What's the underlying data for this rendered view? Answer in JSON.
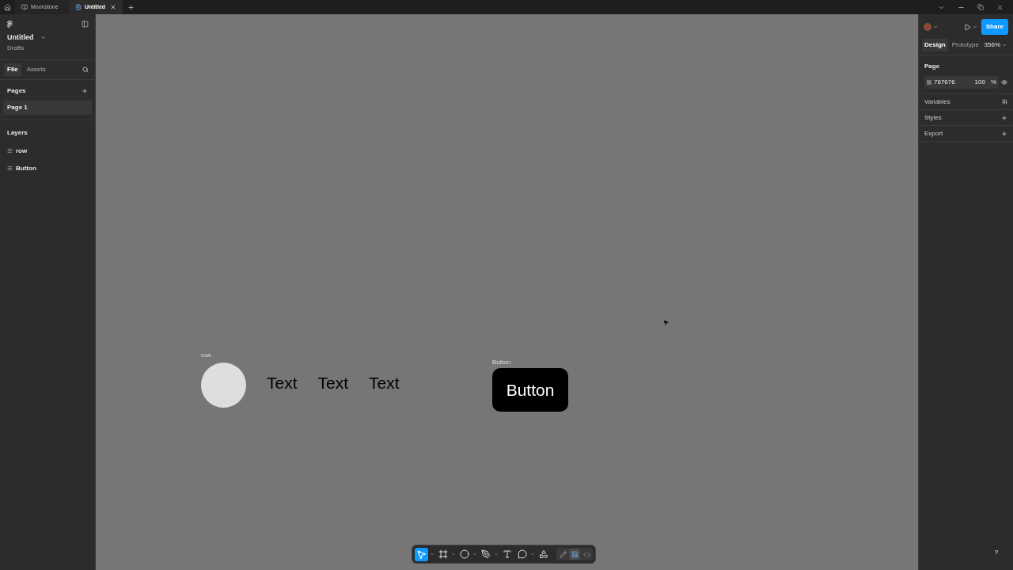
{
  "tabs": [
    {
      "label": "Moonstone",
      "kind": "file",
      "selected": false,
      "closable": false
    },
    {
      "label": "Untitled",
      "kind": "draft",
      "selected": true,
      "closable": true
    }
  ],
  "file": {
    "title": "Untitled",
    "location": "Drafts"
  },
  "left_tabs": [
    {
      "label": "File",
      "selected": true
    },
    {
      "label": "Assets",
      "selected": false
    }
  ],
  "pages": {
    "heading": "Pages",
    "items": [
      {
        "label": "Page 1",
        "selected": true
      }
    ]
  },
  "layers": {
    "heading": "Layers",
    "items": [
      {
        "label": "row"
      },
      {
        "label": "Button"
      }
    ]
  },
  "canvas": {
    "color": "#767676",
    "row": {
      "label": "row",
      "texts": [
        "Text",
        "Text",
        "Text"
      ]
    },
    "button": {
      "label": "Button",
      "text": "Button"
    }
  },
  "right_tabs": [
    {
      "label": "Design",
      "selected": true
    },
    {
      "label": "Prototype",
      "selected": false
    }
  ],
  "zoom": "356%",
  "share": "Share",
  "page_section": {
    "heading": "Page",
    "color_hex": "767676",
    "opacity": "100",
    "unit": "%"
  },
  "sections": [
    {
      "label": "Variables",
      "kind": "variables"
    },
    {
      "label": "Styles",
      "kind": "add"
    },
    {
      "label": "Export",
      "kind": "add"
    }
  ],
  "tools": [
    {
      "kind": "move",
      "selected": true,
      "menu": true
    },
    {
      "kind": "frame",
      "selected": false,
      "menu": true
    },
    {
      "kind": "ellipse",
      "selected": false,
      "menu": true
    },
    {
      "kind": "pen",
      "selected": false,
      "menu": true
    },
    {
      "kind": "text",
      "selected": false,
      "menu": false
    },
    {
      "kind": "comment",
      "selected": false,
      "menu": true
    },
    {
      "kind": "actions",
      "selected": false,
      "menu": false
    }
  ],
  "modes": [
    {
      "kind": "draw",
      "selected": false
    },
    {
      "kind": "design",
      "selected": true
    },
    {
      "kind": "dev",
      "selected": false
    }
  ],
  "help": "?"
}
